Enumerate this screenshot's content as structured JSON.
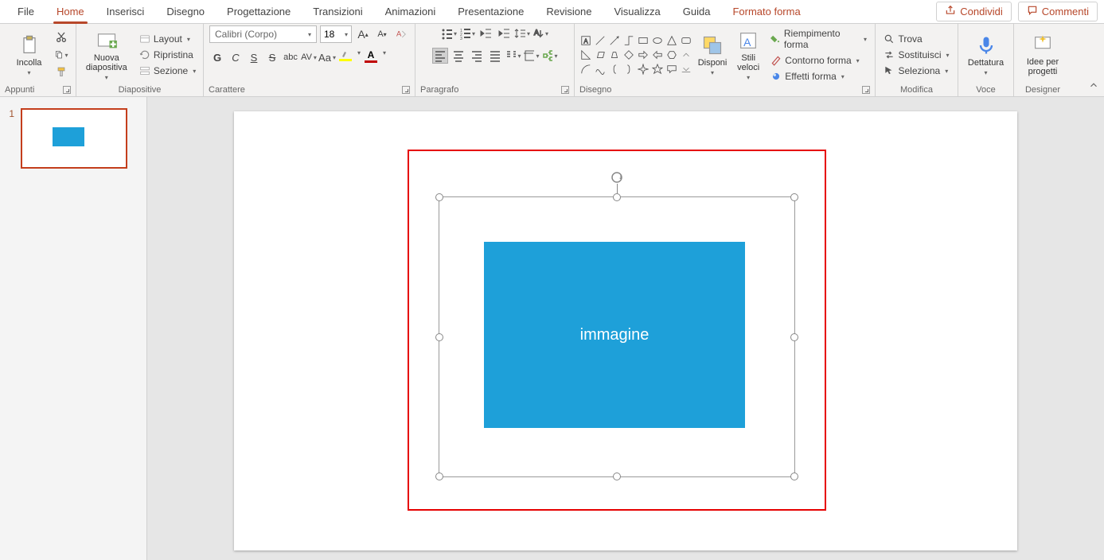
{
  "tabs": {
    "file": "File",
    "home": "Home",
    "insert": "Inserisci",
    "draw": "Disegno",
    "design": "Progettazione",
    "transitions": "Transizioni",
    "animations": "Animazioni",
    "slideshow": "Presentazione",
    "review": "Revisione",
    "view": "Visualizza",
    "help": "Guida",
    "shapeformat": "Formato forma"
  },
  "topButtons": {
    "share": "Condividi",
    "comments": "Commenti"
  },
  "clipboard": {
    "label": "Appunti",
    "paste": "Incolla"
  },
  "slides": {
    "label": "Diapositive",
    "newSlide": "Nuova diapositiva",
    "layout": "Layout",
    "reset": "Ripristina",
    "section": "Sezione"
  },
  "font": {
    "label": "Carattere",
    "name": "Calibri (Corpo)",
    "size": "18",
    "bold": "G",
    "italic": "C",
    "underline": "S",
    "strike": "S",
    "shadow": "abc",
    "spacing": "AV",
    "case": "Aa",
    "highlightColor": "#ffff00",
    "fontColor": "#c00000"
  },
  "paragraph": {
    "label": "Paragrafo"
  },
  "drawing": {
    "label": "Disegno",
    "arrange": "Disponi",
    "quickstyles": "Stili veloci",
    "fill": "Riempimento forma",
    "outline": "Contorno forma",
    "effects": "Effetti forma"
  },
  "editing": {
    "label": "Modifica",
    "find": "Trova",
    "replace": "Sostituisci",
    "select": "Seleziona"
  },
  "voice": {
    "label": "Voce",
    "dictate": "Dettatura"
  },
  "designer": {
    "label": "Designer",
    "ideas": "Idee per progetti"
  },
  "thumb": {
    "num": "1"
  },
  "canvas": {
    "shapeText": "immagine"
  }
}
